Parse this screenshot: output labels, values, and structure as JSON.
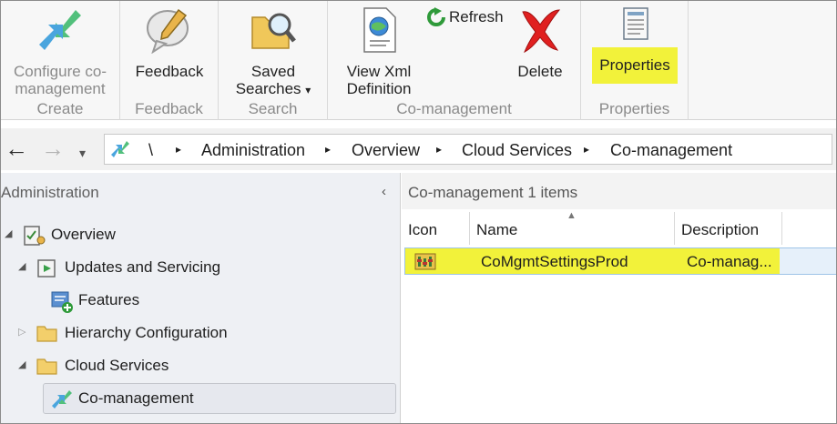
{
  "ribbon": {
    "groups": {
      "create": {
        "label": "Create",
        "buttons": {
          "configure_comanagement": {
            "label_line1": "Configure co-",
            "label_line2": "management",
            "icon": "configure-comanagement-icon"
          }
        }
      },
      "feedback": {
        "label": "Feedback",
        "buttons": {
          "feedback": {
            "label": "Feedback",
            "icon": "feedback-bubble-icon"
          }
        }
      },
      "search": {
        "label": "Search",
        "buttons": {
          "saved_searches": {
            "label_line1": "Saved",
            "label_line2": "Searches",
            "dropdown_glyph": "▾",
            "icon": "saved-searches-icon"
          }
        }
      },
      "comanagement": {
        "label": "Co-management",
        "buttons": {
          "view_xml": {
            "label_line1": "View Xml",
            "label_line2": "Definition",
            "icon": "xml-document-icon"
          },
          "refresh": {
            "label": "Refresh",
            "icon": "refresh-icon"
          },
          "delete": {
            "label": "Delete",
            "icon": "delete-icon"
          }
        }
      },
      "properties": {
        "label": "Properties",
        "buttons": {
          "properties": {
            "label": "Properties",
            "icon": "properties-icon"
          }
        }
      }
    }
  },
  "address_bar": {
    "back_glyph": "←",
    "forward_glyph": "→",
    "history_glyph": "▾",
    "root": "\\",
    "crumbs": [
      "Administration",
      "Overview",
      "Cloud Services",
      "Co-management"
    ],
    "separator": "▸"
  },
  "navigation_pane": {
    "header": "Administration",
    "collapse_glyph": "‹",
    "items": [
      {
        "label": "Overview",
        "expander": "◢",
        "icon": "overview-icon"
      },
      {
        "label": "Updates and Servicing",
        "expander": "◢",
        "icon": "updates-servicing-icon"
      },
      {
        "label": "Features",
        "expander": "",
        "icon": "features-icon"
      },
      {
        "label": "Hierarchy Configuration",
        "expander": "▷",
        "icon": "folder-icon"
      },
      {
        "label": "Cloud Services",
        "expander": "◢",
        "icon": "folder-icon"
      },
      {
        "label": "Co-management",
        "expander": "",
        "icon": "comanagement-icon"
      }
    ]
  },
  "results_pane": {
    "title": "Co-management 1 items",
    "columns": [
      "Icon",
      "Name",
      "Description"
    ],
    "rows": [
      {
        "icon": "comanagement-settings-icon",
        "name": "CoMgmtSettingsProd",
        "description": "Co-manag..."
      }
    ]
  },
  "colors": {
    "highlight": "#f2f23a",
    "ribbon_bg": "#f7f7f7",
    "nav_bg": "#eef0f4",
    "selection_border": "#9fc4e8"
  }
}
